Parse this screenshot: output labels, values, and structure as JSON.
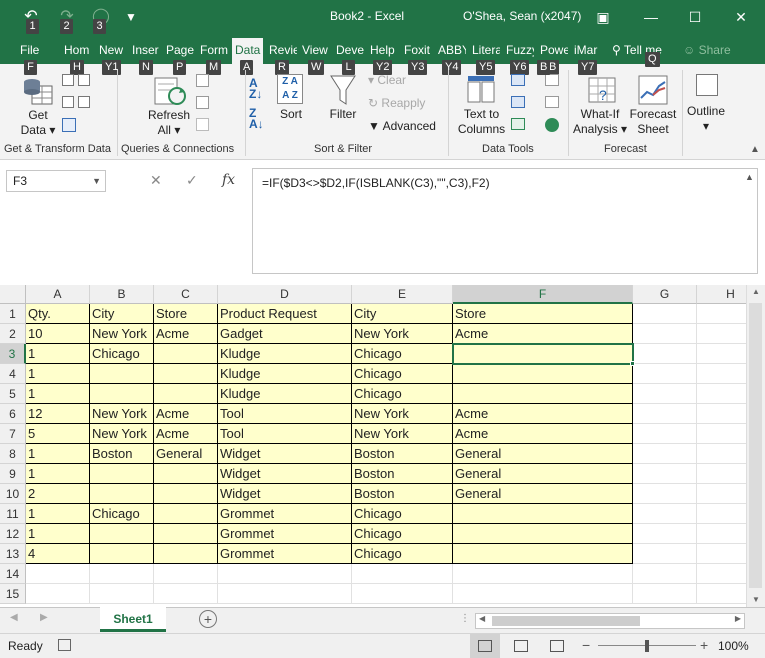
{
  "titlebar": {
    "title": "Book2  -  Excel",
    "user": "O'Shea, Sean (x2047)",
    "keytips": [
      "1",
      "2",
      "3"
    ]
  },
  "tabs": [
    {
      "label": "File",
      "keytip": "F"
    },
    {
      "label": "Hom",
      "keytip": "H"
    },
    {
      "label": "New",
      "keytip": "Y1"
    },
    {
      "label": "Inser",
      "keytip": "N"
    },
    {
      "label": "Page",
      "keytip": "P"
    },
    {
      "label": "Form",
      "keytip": "M"
    },
    {
      "label": "Data",
      "keytip": "A",
      "active": true
    },
    {
      "label": "Revie",
      "keytip": "R"
    },
    {
      "label": "View",
      "keytip": "W"
    },
    {
      "label": "Deve",
      "keytip": "L"
    },
    {
      "label": "Help",
      "keytip": "Y2"
    },
    {
      "label": "Foxit",
      "keytip": "Y3"
    },
    {
      "label": "ABBY",
      "keytip": "Y4"
    },
    {
      "label": "Litera",
      "keytip": "Y5"
    },
    {
      "label": "Fuzzy",
      "keytip": "Y6"
    },
    {
      "label": "Powe",
      "keytip": "B"
    },
    {
      "label": "iMar",
      "keytip": "Y7"
    }
  ],
  "tellme": {
    "label": "Tell me",
    "keytip": "Q"
  },
  "share": "Share",
  "ribbon": {
    "get_data": [
      "Get",
      "Data"
    ],
    "refresh_all": [
      "Refresh",
      "All"
    ],
    "sort": "Sort",
    "filter": "Filter",
    "clear": "Clear",
    "reapply": "Reapply",
    "advanced": "Advanced",
    "text_to_columns": [
      "Text to",
      "Columns"
    ],
    "what_if": [
      "What-If",
      "Analysis"
    ],
    "forecast_sheet": [
      "Forecast",
      "Sheet"
    ],
    "outline": "Outline",
    "groups": {
      "get_transform": "Get & Transform Data",
      "queries": "Queries & Connections",
      "sort_filter": "Sort & Filter",
      "data_tools": "Data Tools",
      "forecast": "Forecast"
    }
  },
  "formula_bar": {
    "name_box": "F3",
    "fx": "fx",
    "formula": "=IF($D3<>$D2,IF(ISBLANK(C3),\"\",C3),F2)"
  },
  "grid": {
    "columns": [
      "A",
      "B",
      "C",
      "D",
      "E",
      "F",
      "G",
      "H"
    ],
    "selected_column": "F",
    "selected_row": 3,
    "row_numbers": [
      "1",
      "2",
      "3",
      "4",
      "5",
      "6",
      "7",
      "8",
      "9",
      "10",
      "11",
      "12",
      "13",
      "14",
      "15"
    ],
    "rows": [
      [
        "Qty.",
        "City",
        "Store",
        "Product Request",
        "City",
        "Store"
      ],
      [
        "10",
        "New York",
        "Acme",
        "Gadget",
        "New York",
        "Acme"
      ],
      [
        "1",
        "Chicago",
        "",
        "Kludge",
        "Chicago",
        ""
      ],
      [
        "1",
        "",
        "",
        "Kludge",
        "Chicago",
        ""
      ],
      [
        "1",
        "",
        "",
        "Kludge",
        "Chicago",
        ""
      ],
      [
        "12",
        "New York",
        "Acme",
        "Tool",
        "New York",
        "Acme"
      ],
      [
        "5",
        "New York",
        "Acme",
        "Tool",
        "New York",
        "Acme"
      ],
      [
        "1",
        "Boston",
        "General",
        "Widget",
        "Boston",
        "General"
      ],
      [
        "1",
        "",
        "",
        "Widget",
        "Boston",
        "General"
      ],
      [
        "2",
        "",
        "",
        "Widget",
        "Boston",
        "General"
      ],
      [
        "1",
        "Chicago",
        "",
        "Grommet",
        "Chicago",
        ""
      ],
      [
        "1",
        "",
        "",
        "Grommet",
        "Chicago",
        ""
      ],
      [
        "4",
        "",
        "",
        "Grommet",
        "Chicago",
        ""
      ]
    ]
  },
  "sheet_tab": "Sheet1",
  "status": {
    "ready": "Ready",
    "zoom": "100%"
  },
  "colors": {
    "accent": "#217346",
    "cell_fill": "#ffffcc"
  }
}
